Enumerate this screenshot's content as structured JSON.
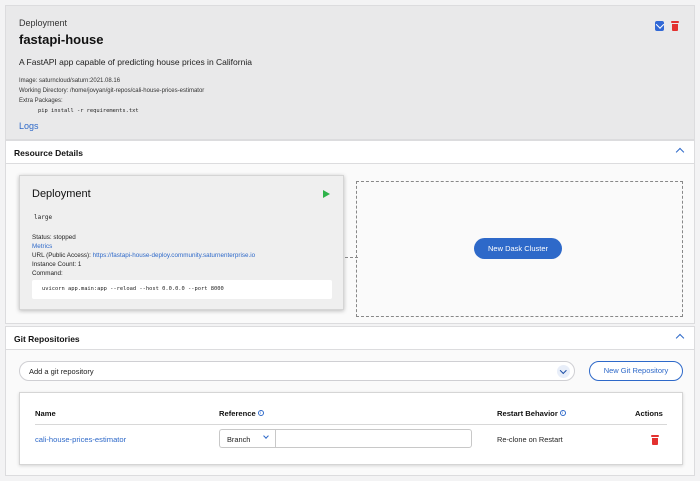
{
  "header": {
    "kicker": "Deployment",
    "title": "fastapi-house",
    "description": "A FastAPI app capable of predicting house prices in California",
    "image_line": "Image: saturncloud/saturn:2021.08.16",
    "workdir_line": "Working Directory: /home/jovyan/git-repos/cali-house-prices-estimator",
    "extra_packages_label": "Extra Packages:",
    "pip_command": "pip install -r requirements.txt",
    "logs_link": "Logs",
    "icons": {
      "edit": "edit-icon",
      "delete": "trash-icon"
    },
    "colors": {
      "edit": "#3168d6",
      "delete": "#e3312f"
    }
  },
  "resource_details": {
    "heading": "Resource Details",
    "card": {
      "title": "Deployment",
      "size": "large",
      "status": "Status: stopped",
      "metrics_link": "Metrics",
      "url_label": "URL (Public Access): ",
      "url_value": "https://fastapi-house-deploy.community.saturnenterprise.io",
      "instance_count": "Instance Count: 1",
      "command_label": "Command:",
      "command": "uvicorn app.main:app --reload --host 0.0.0.0 --port 8000",
      "icons": {
        "start": "play-icon"
      },
      "colors": {
        "start": "#2fb34a"
      }
    },
    "dask_button": "New Dask Cluster"
  },
  "git_repositories": {
    "heading": "Git Repositories",
    "add_placeholder": "Add a git repository",
    "new_button": "New Git Repository",
    "columns": {
      "name": "Name",
      "reference": "Reference",
      "restart": "Restart Behavior",
      "actions": "Actions"
    },
    "rows": [
      {
        "name": "cali-house-prices-estimator",
        "ref_type": "Branch",
        "ref_value": "",
        "restart": "Re-clone on Restart"
      }
    ]
  },
  "accent_color": "#2e69c9"
}
